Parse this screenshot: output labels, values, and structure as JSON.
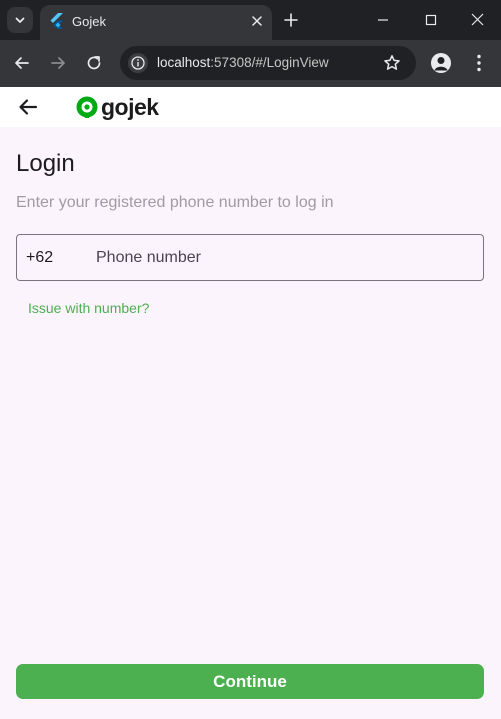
{
  "browser": {
    "tab": {
      "title": "Gojek",
      "favicon": "flutter-logo-icon"
    },
    "url": {
      "host": "localhost",
      "rest": ":57308/#/LoginView"
    },
    "colors": {
      "frame": "#202124",
      "toolbar": "#35363a"
    }
  },
  "app": {
    "logo_text": "gojek",
    "title": "Login",
    "subtitle": "Enter your registered phone number to log in",
    "phone": {
      "prefix": "+62",
      "placeholder": "Phone number",
      "value": ""
    },
    "issue_link": "Issue with number?",
    "continue_label": "Continue",
    "colors": {
      "accent": "#4caf50",
      "background": "#fcf4fc",
      "brand": "#00aa13"
    }
  }
}
